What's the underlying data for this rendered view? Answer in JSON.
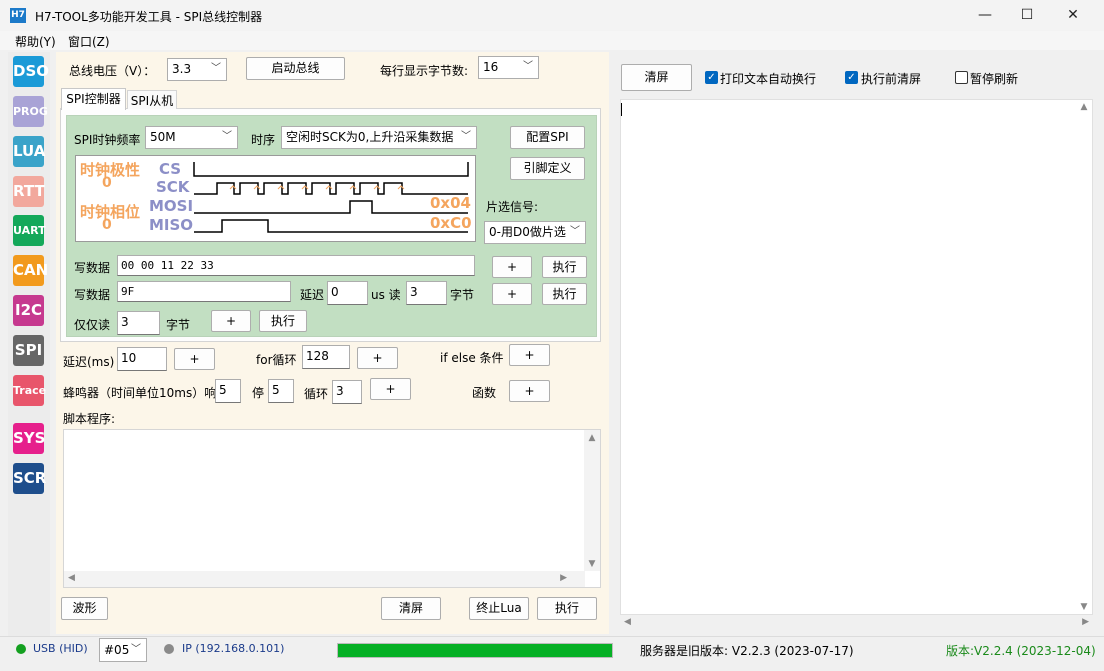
{
  "window": {
    "app_icon": "H7",
    "title": "H7-TOOL多功能开发工具 - SPI总线控制器",
    "minimize": "—",
    "maximize": "☐",
    "close": "✕"
  },
  "menu": {
    "help": "帮助(Y)",
    "window": "窗口(Z)"
  },
  "sidebar": {
    "items": [
      {
        "label": "DSO",
        "color": "#1a9ad7"
      },
      {
        "label": "PROG",
        "color": "#a9a3d6"
      },
      {
        "label": "LUA",
        "color": "#3aa3c9"
      },
      {
        "label": "RTT",
        "color": "#f2a89d"
      },
      {
        "label": "UART",
        "color": "#14a85a"
      },
      {
        "label": "CAN",
        "color": "#f29a1d"
      },
      {
        "label": "I2C",
        "color": "#c6398f"
      },
      {
        "label": "SPI",
        "color": "#666666"
      },
      {
        "label": "Trace",
        "color": "#e8556b"
      },
      {
        "label": "SYS",
        "color": "#e6208c"
      },
      {
        "label": "SCR",
        "color": "#1e4e8c"
      }
    ]
  },
  "top_controls": {
    "voltage_label": "总线电压（V）：",
    "voltage_value": "3.3",
    "start_bus": "启动总线",
    "bytes_per_line_label": "每行显示字节数:",
    "bytes_per_line_value": "16"
  },
  "tabs": {
    "controller": "SPI控制器",
    "slave": "SPI从机"
  },
  "spi": {
    "clock_label": "SPI时钟频率",
    "clock_value": "50M",
    "timing_label": "时序",
    "timing_value": "空闲时SCK为0,上升沿采集数据",
    "config_button": "配置SPI",
    "pin_button": "引脚定义",
    "cs_label": "片选信号:",
    "cs_value": "0-用D0做片选",
    "diagram": {
      "polarity_label": "时钟极性",
      "polarity_value": "0",
      "phase_label": "时钟相位",
      "phase_value": "0",
      "sig_cs": "CS",
      "sig_sck": "SCK",
      "sig_mosi": "MOSI",
      "sig_miso": "MISO",
      "mosi_hex": "0x04",
      "miso_hex": "0xC0"
    },
    "write1_label": "写数据",
    "write1_value": "00 00 11 22 33",
    "write2_label": "写数据",
    "write2_value": "9F",
    "delay_label": "延迟",
    "delay_value": "0",
    "us_read": "us 读",
    "read_value": "3",
    "bytes_unit": "字节",
    "readonly_label": "仅仅读",
    "readonly_value": "3",
    "readonly_unit": "字节",
    "plus": "+",
    "exec": "执行"
  },
  "script_tools": {
    "delay_label": "延迟(ms)",
    "delay_value": "10",
    "for_label": "for循环",
    "for_value": "128",
    "ifelse_label": "if else 条件",
    "beep_label": "蜂鸣器（时间单位10ms）响",
    "beep_on": "5",
    "stop_label": "停",
    "beep_off": "5",
    "loop_label": "循环",
    "loop_value": "3",
    "func_label": "函数",
    "plus": "+",
    "script_label": "脚本程序:"
  },
  "bottom_buttons": {
    "wave": "波形",
    "clear": "清屏",
    "stop_lua": "终止Lua",
    "exec": "执行"
  },
  "output_panel": {
    "clear": "清屏",
    "wrap_label": "打印文本自动换行",
    "wrap_checked": true,
    "clear_before_label": "执行前清屏",
    "clear_before_checked": true,
    "pause_label": "暂停刷新",
    "pause_checked": false
  },
  "status": {
    "usb": "USB (HID)",
    "usb_color": "#14a020",
    "port": "#05",
    "ip": "IP (192.168.0.101)",
    "progress": 1.0,
    "progress_color": "#06b025",
    "server_version": "服务器是旧版本: V2.2.3 (2023-07-17)",
    "version": "版本:V2.2.4 (2023-12-04)",
    "version_color": "#1a8a1a"
  }
}
